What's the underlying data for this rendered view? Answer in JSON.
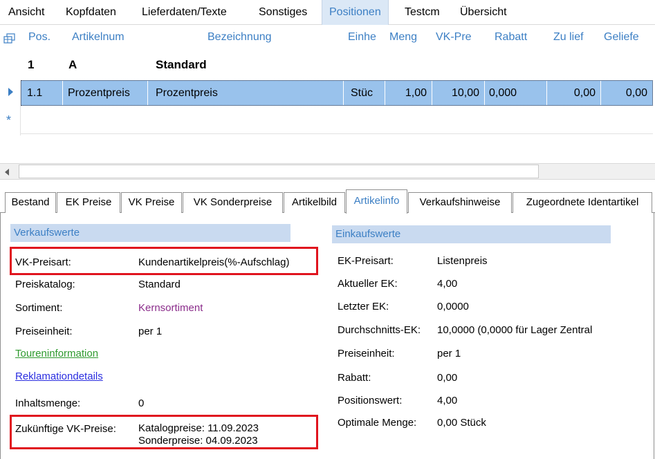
{
  "top_tabs": [
    "Ansicht",
    "Kopfdaten",
    "Lieferdaten/Texte",
    "Sonstiges",
    "Positionen",
    "Testcm",
    "Übersicht"
  ],
  "grid": {
    "columns": [
      "Pos.",
      "Artikelnum",
      "Bezeichnung",
      "Einhe",
      "Meng",
      "VK-Pre",
      "Rabatt",
      "Zu lief",
      "Geliefe"
    ],
    "group_row": {
      "pos": "1",
      "artikel": "A",
      "bezeichnung": "Standard"
    },
    "selected_row": {
      "pos": "1.1",
      "artikel": "Prozentpreis",
      "bezeichnung": "Prozentpreis",
      "einheit": "Stüc",
      "menge": "1,00",
      "vk_preis": "10,00",
      "rabatt": "0,000",
      "zu_liefern": "0,00",
      "geliefert": "0,00"
    },
    "new_row_marker": "*"
  },
  "lower_tabs": [
    "Bestand",
    "EK Preise",
    "VK Preise",
    "VK Sonderpreise",
    "Artikelbild",
    "Artikelinfo",
    "Verkaufshinweise",
    "Zugeordnete Identartikel"
  ],
  "verkaufswerte": {
    "title": "Verkaufswerte",
    "vk_preisart_label": "VK-Preisart:",
    "vk_preisart_value": "Kundenartikelpreis(%-Aufschlag)",
    "preiskatalog_label": "Preiskatalog:",
    "preiskatalog_value": "Standard",
    "sortiment_label": "Sortiment:",
    "sortiment_value": "Kernsortiment",
    "preiseinheit_label": "Preiseinheit:",
    "preiseinheit_value": "per 1",
    "toureninfo_link": "Toureninformation",
    "reklamation_link": "Reklamationdetails",
    "inhaltsmenge_label": "Inhaltsmenge:",
    "inhaltsmenge_value": "0",
    "zukuenftige_label": "Zukünftige VK-Preise:",
    "katalogpreise": "Katalogpreise:  11.09.2023",
    "sonderpreise": "Sonderpreise: 04.09.2023"
  },
  "einkaufswerte": {
    "title": "Einkaufswerte",
    "ek_preisart_label": "EK-Preisart:",
    "ek_preisart_value": "Listenpreis",
    "aktueller_ek_label": "Aktueller EK:",
    "aktueller_ek_value": "4,00",
    "letzter_ek_label": "Letzter EK:",
    "letzter_ek_value": "0,0000",
    "durchschnitts_ek_label": "Durchschnitts-EK:",
    "durchschnitts_ek_value": "10,0000 (0,0000 für Lager Zentral",
    "preiseinheit_label": "Preiseinheit:",
    "preiseinheit_value": "per 1",
    "rabatt_label": "Rabatt:",
    "rabatt_value": "0,00",
    "positionswert_label": "Positionswert:",
    "positionswert_value": "4,00",
    "optimale_menge_label": "Optimale Menge:",
    "optimale_menge_value": "0,00 Stück"
  },
  "colors": {
    "accent": "#3c7fc4",
    "selection": "#99c2ec",
    "highlight_box": "#e0141e"
  }
}
